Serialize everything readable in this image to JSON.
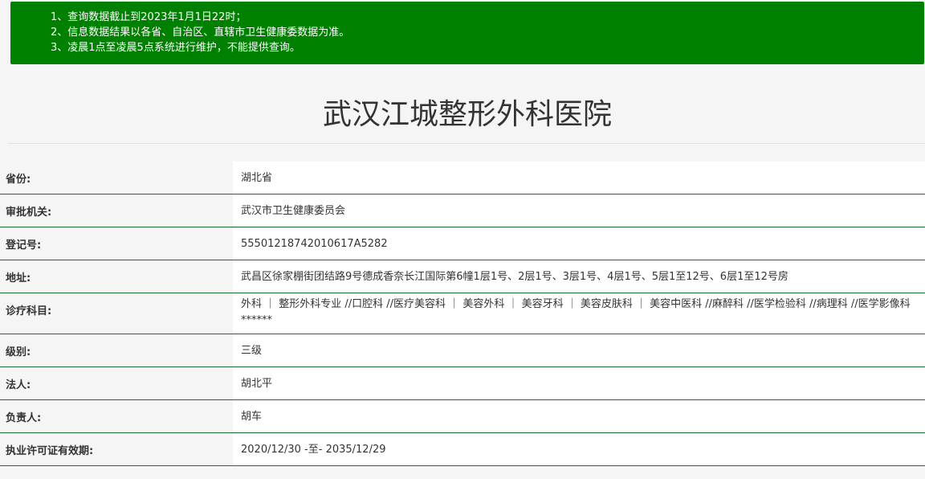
{
  "notice": {
    "lines": [
      "1、查询数据截止到2023年1月1日22时；",
      "2、信息数据结果以各省、自治区、直辖市卫生健康委数据为准。",
      "3、凌晨1点至凌晨5点系统进行维护，不能提供查询。"
    ]
  },
  "hospital": {
    "name": "武汉江城整形外科医院"
  },
  "fields": [
    {
      "label": "省份:",
      "value": "湖北省"
    },
    {
      "label": "审批机关:",
      "value": "武汉市卫生健康委员会"
    },
    {
      "label": "登记号:",
      "value": "55501218742010617A5282"
    },
    {
      "label": "地址:",
      "value": "武昌区徐家棚街团结路9号德成香奈长江国际第6幢1层1号、2层1号、3层1号、4层1号、5层1至12号、6层1至12号房"
    },
    {
      "label": "诊疗科目:",
      "value": "外科 ｜ 整形外科专业 //口腔科 //医疗美容科 ｜ 美容外科 ｜ 美容牙科 ｜ 美容皮肤科 ｜ 美容中医科 //麻醉科 //医学检验科 //病理科 //医学影像科******"
    },
    {
      "label": "级别:",
      "value": "三级"
    },
    {
      "label": "法人:",
      "value": "胡北平"
    },
    {
      "label": "负责人:",
      "value": "胡车"
    },
    {
      "label": "执业许可证有效期:",
      "value": "2020/12/30 -至- 2035/12/29"
    }
  ]
}
